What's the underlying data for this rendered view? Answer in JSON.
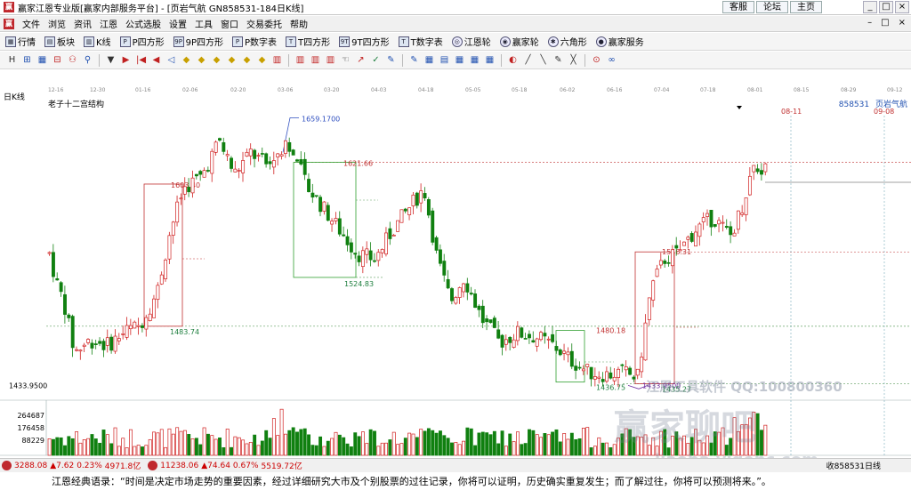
{
  "window": {
    "title": "赢家江恩专业版[赢家内部服务平台] - [页岩气航   GN858531-184日K线]",
    "top_links": [
      "客服",
      "论坛",
      "主页"
    ],
    "controls": [
      "_",
      "□",
      "×"
    ]
  },
  "menu": {
    "items": [
      "文件",
      "浏览",
      "资讯",
      "江恩",
      "公式选股",
      "设置",
      "工具",
      "窗口",
      "交易委托",
      "帮助"
    ],
    "right_controls": [
      "–",
      "□",
      "×"
    ]
  },
  "toolbar1": {
    "items": [
      {
        "icon": "grid-icon",
        "label": "行情"
      },
      {
        "icon": "blocks-icon",
        "label": "板块"
      },
      {
        "icon": "kline-icon",
        "label": "K线"
      },
      {
        "icon": "p-icon",
        "label": "P四方形"
      },
      {
        "icon": "9p-icon",
        "label": "9P四方形"
      },
      {
        "icon": "p-table-icon",
        "label": "P数字表"
      },
      {
        "icon": "t-icon",
        "label": "T四方形"
      },
      {
        "icon": "9t-icon",
        "label": "9T四方形"
      },
      {
        "icon": "t-table-icon",
        "label": "T数字表"
      },
      {
        "icon": "gann-wheel-icon",
        "label": "江恩轮"
      },
      {
        "icon": "winner-wheel-icon",
        "label": "赢家轮"
      },
      {
        "icon": "hexagon-icon",
        "label": "六角形"
      },
      {
        "icon": "service-icon",
        "label": "赢家服务"
      }
    ]
  },
  "toolbar2": {
    "icons": [
      "H",
      "⊞",
      "▦",
      "⊟",
      "⚇",
      "⚲",
      "▼",
      "▶",
      "|◀",
      "◀",
      "◁",
      "◆",
      "◆",
      "◆",
      "◆",
      "◆",
      "◆",
      "▥",
      "▥",
      "▥",
      "▥",
      "☜",
      "↗",
      "✓",
      "✎",
      "✎",
      "▦",
      "▤",
      "▦",
      "▦",
      "▦",
      "◐",
      "╱",
      "╲",
      "✎",
      "╳",
      "⊙",
      "∞"
    ]
  },
  "chart": {
    "period_label": "日K线",
    "structure_label": "老子十二宫结构",
    "stock_code": "858531",
    "stock_name": "页岩气航",
    "dates_top": [
      "12-16",
      "12-30",
      "01-16",
      "02-06",
      "02-20",
      "03-06",
      "03-20",
      "04-03",
      "04-18",
      "05-05",
      "05-18",
      "06-02",
      "06-16",
      "07-04",
      "07-18",
      "08-01",
      "08-15",
      "08-29",
      "09-12"
    ],
    "date_markers": [
      "08-11",
      "09-08"
    ],
    "price_labels": {
      "high": "1659.1700",
      "p1": "1603.40",
      "p2": "1621.66",
      "p3": "1524.83",
      "p4": "1483.74",
      "p5": "1480.18",
      "p6": "1546.31",
      "p7": "1433.9500",
      "p8": "1436.75",
      "p9": "1435.27"
    },
    "axis_price": "1433.9500",
    "volume_axis": [
      "264687",
      "176458",
      "88229"
    ]
  },
  "chart_data": {
    "type": "candlestick",
    "ylim": [
      1420,
      1670
    ],
    "reference_levels": [
      1621.66,
      1603.4,
      1546.31,
      1524.83,
      1483.74,
      1480.18,
      1435.27
    ],
    "volume_ylim": [
      0,
      400000
    ]
  },
  "watermark": {
    "text": "江恩工具软件  QQ:100800360",
    "logo": "赢家聊吧",
    "url": "liaoba.yjgenc.com"
  },
  "status": {
    "index1": {
      "value": "3288.08",
      "change": "▲7.62",
      "pct": "0.23%",
      "amount": "4971.8亿"
    },
    "index2": {
      "value": "11238.06",
      "change": "▲74.64",
      "pct": "0.67%",
      "amount": "5519.72亿"
    },
    "right_text": "收858531日线"
  },
  "quote": "江恩经典语录：“时间是决定市场走势的重要因素，经过详细研究大市及个别股票的过往记录，你将可以证明，历史确实重复发生；而了解过往，你将可以预测将来。”。"
}
